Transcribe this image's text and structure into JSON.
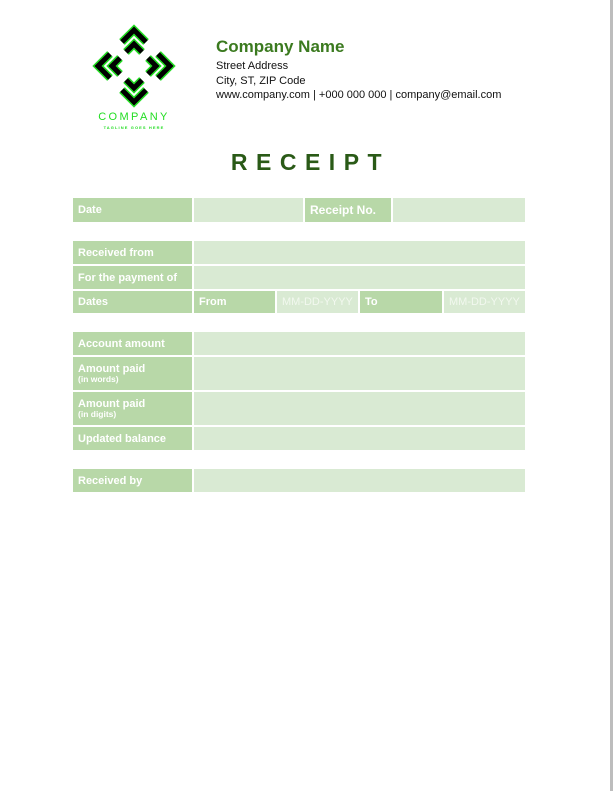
{
  "logo": {
    "name": "COMPANY",
    "tagline": "TAGLINE GOES HERE",
    "icon": "diamond-knot-logo-icon",
    "colors": {
      "outline": "#22dd22",
      "fill": "#000000"
    }
  },
  "company": {
    "name": "Company Name",
    "street": "Street Address",
    "city": "City, ST, ZIP Code",
    "contact": "www.company.com | +000 000 000 | company@email.com"
  },
  "title": "RECEIPT",
  "colors": {
    "label_bg": "#b8d8a8",
    "value_bg": "#d9ead3",
    "title": "#2a5a17",
    "company_name": "#3b7a1f"
  },
  "form": {
    "date_label": "Date",
    "date_value": "",
    "receipt_no_label": "Receipt No.",
    "receipt_no_value": "",
    "received_from_label": "Received from",
    "received_from_value": "",
    "payment_of_label": "For the payment of",
    "payment_of_value": "",
    "dates_label": "Dates",
    "from_label": "From",
    "from_placeholder": "MM-DD-YYYY",
    "to_label": "To",
    "to_placeholder": "MM-DD-YYYY",
    "account_amount_label": "Account amount",
    "account_amount_value": "",
    "amount_words_label": "Amount paid",
    "amount_words_sub": "(in words)",
    "amount_words_value": "",
    "amount_digits_label": "Amount paid",
    "amount_digits_sub": "(in digits)",
    "amount_digits_value": "",
    "updated_balance_label": "Updated balance",
    "updated_balance_value": "",
    "received_by_label": "Received by",
    "received_by_value": ""
  }
}
